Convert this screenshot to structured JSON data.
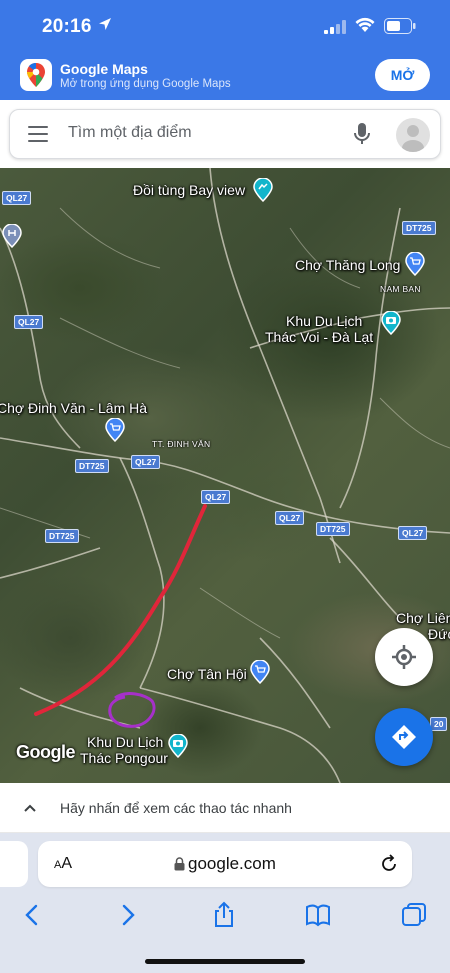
{
  "status_bar": {
    "time": "20:16",
    "icons": [
      "location-arrow-icon",
      "cellular-signal-icon",
      "wifi-icon",
      "battery-icon"
    ]
  },
  "app_banner": {
    "title": "Google Maps",
    "subtitle": "Mở trong ứng dụng Google Maps",
    "open_button": "MỞ",
    "icon": "google-maps-logo-icon"
  },
  "search": {
    "placeholder": "Tìm một địa điểm",
    "icons": [
      "menu-icon",
      "microphone-icon",
      "avatar-icon"
    ]
  },
  "map": {
    "places": {
      "doi_tung": "Đồi tùng Bay view",
      "cho_thang_long": "Chợ Thăng Long",
      "nam_ban": "NAM BAN",
      "khu_du_lich_thac_voi_1": "Khu Du Lịch",
      "khu_du_lich_thac_voi_2": "Thác Voi - Đà Lạt",
      "cho_dinh_van": "Chợ Đinh Văn - Lâm Hà",
      "tt_dinh_van": "TT. ĐINH VĂN",
      "cho_lien_1": "Chợ Liên",
      "cho_lien_2": "Đức",
      "cho_tan_hoi": "Chợ Tân Hội",
      "khu_du_lich_pongour_1": "Khu Du Lịch",
      "khu_du_lich_pongour_2": "Thác Pongour"
    },
    "road_shields": {
      "ql27_a": "QL27",
      "dt725_a": "DT725",
      "ql27_b": "QL27",
      "dt725_b": "DT725",
      "ql27_c": "QL27",
      "ql27_d": "QL27",
      "dt725_c": "DT725",
      "ql27_e": "QL27",
      "dt725_d": "DT725",
      "ql27_f": "QL27",
      "edge_20": "20"
    },
    "watermark": "Google",
    "annotation_colors": {
      "red_line": "#e0263a",
      "purple_circle": "#a630c9"
    }
  },
  "quick_actions": {
    "text": "Hãy nhấn để xem các thao tác nhanh"
  },
  "browser": {
    "aa_label": "AA",
    "url": "google.com",
    "icons": [
      "back-icon",
      "forward-icon",
      "share-icon",
      "bookmarks-icon",
      "tabs-icon",
      "reload-icon",
      "lock-icon"
    ]
  },
  "colors": {
    "banner_blue": "#3b78e7",
    "google_blue": "#1a73e8"
  }
}
